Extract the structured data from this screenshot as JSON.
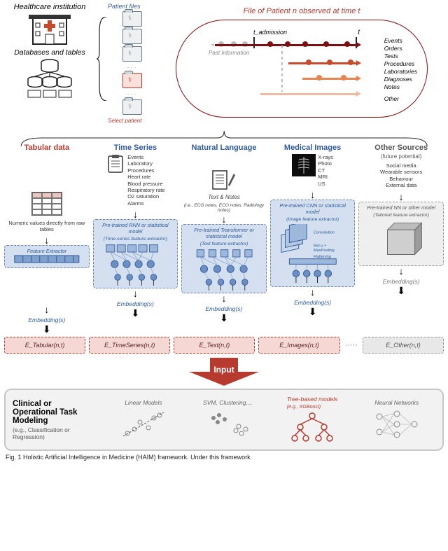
{
  "top": {
    "healthcare_institution": "Healthcare institution",
    "databases_and_tables": "Databases and tables",
    "patient_files": "Patient files",
    "select_patient": "Select patient",
    "file_of_patient": "File of Patient n observed at time t",
    "t_admission": "t_admission",
    "t": "t",
    "past_information": "Past Information",
    "event_list": [
      "Events",
      "Orders",
      "Tests",
      "Procedures",
      "Laboratories",
      "Diagnoses",
      "Notes",
      "",
      "Other"
    ]
  },
  "columns": {
    "tabular": {
      "title": "Tabular data",
      "desc": "Numeric values directly from raw tables",
      "model": "Feature Extractor",
      "embed": "Embedding(s)",
      "ebox": "E_Tabular(n,t)"
    },
    "timeseries": {
      "title": "Time Series",
      "items": [
        "Events",
        "Laboratory",
        "Procedures",
        "Heart rate",
        "Blood pressure",
        "Respiratory rate",
        "O2 saturation",
        "Alarms"
      ],
      "model": "Pre-trained RNN or statistical model",
      "model_sub": "(Time-series feature extractor)",
      "embed": "Embedding(s)",
      "ebox": "E_TimeSeries(n,t)"
    },
    "nlp": {
      "title": "Natural Language",
      "cap": "Text & Notes",
      "cap_sub": "(i.e., ECG notes, ECO notes, Radiology notes)",
      "model": "Pre-trained Transformer or statistical model",
      "model_sub": "(Text feature extractor)",
      "embed": "Embedding(s)",
      "ebox": "E_Text(n,t)"
    },
    "images": {
      "title": "Medical Images",
      "items": [
        "X-rays",
        "Photo",
        "CT",
        "MRI",
        "US"
      ],
      "model": "Pre-trained CNN or statistical model",
      "model_sub": "(Image feature extractor)",
      "layers": [
        "Convolution",
        "ReLu + MaxPooling",
        "Flattening"
      ],
      "embed": "Embedding(s)",
      "ebox": "E_Images(n,t)"
    },
    "other": {
      "title": "Other Sources",
      "title_sub": "(future potential)",
      "items": [
        "Social media",
        "Wearable sensors",
        "Behaviour",
        "External data"
      ],
      "model": "Pre-trained NN or other model",
      "model_sub": "(Tailored feature extractor)",
      "embed": "Embedding(s)",
      "ebox": "E_Other(n,t)"
    },
    "ellipsis": "·····"
  },
  "input_label": "Input",
  "bottom": {
    "title": "Clinical or Operational Task Modeling",
    "sub": "(e.g., Classification or Regression)",
    "models": [
      "Linear Models",
      "SVM, Clustering,...",
      "Tree-based models",
      "Neural Networks"
    ],
    "tree_sub": "(e.g., XGBoost)"
  },
  "caption": "Fig. 1 Holistic Artificial Intelligence in Medicine (HAIM) framework. Under this framework"
}
